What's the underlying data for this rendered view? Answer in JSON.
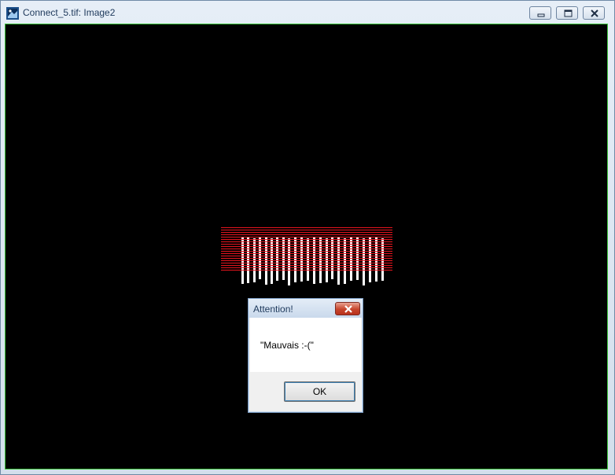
{
  "window": {
    "title": "Connect_5.tif: Image2",
    "controls": [
      "minimize-icon",
      "restore-icon",
      "close-icon"
    ]
  },
  "canvas": {
    "background": "#000000",
    "frame_color": "#3cc43c",
    "stripe_color": "#e8141e",
    "bar_color": "#ffffff"
  },
  "dialog": {
    "title": "Attention!",
    "message": "\"Mauvais :-(\"",
    "ok_label": "OK",
    "close_icon": "close-icon"
  }
}
